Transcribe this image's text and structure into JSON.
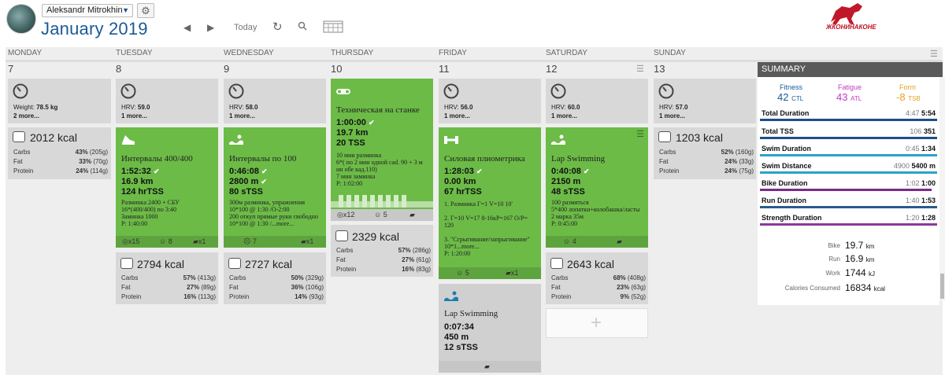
{
  "header": {
    "user": "Aleksandr Mitrokhin",
    "month": "January",
    "year": "2019",
    "today": "Today",
    "logo_text": "ЖКОНИНАКОНЕ"
  },
  "days": [
    {
      "name": "MONDAY",
      "num": "7"
    },
    {
      "name": "TUESDAY",
      "num": "8"
    },
    {
      "name": "WEDNESDAY",
      "num": "9"
    },
    {
      "name": "THURSDAY",
      "num": "10"
    },
    {
      "name": "FRIDAY",
      "num": "11"
    },
    {
      "name": "SATURDAY",
      "num": "12"
    },
    {
      "name": "SUNDAY",
      "num": "13"
    }
  ],
  "metrics": {
    "mon": {
      "label": "Weight:",
      "value": "78.5 kg",
      "more": "2 more..."
    },
    "tue": {
      "label": "HRV:",
      "value": "59.0",
      "more": "1 more..."
    },
    "wed": {
      "label": "HRV:",
      "value": "58.0",
      "more": "1 more..."
    },
    "fri": {
      "label": "HRV:",
      "value": "56.0",
      "more": "1 more..."
    },
    "sat": {
      "label": "HRV:",
      "value": "60.0",
      "more": "1 more..."
    },
    "sun": {
      "label": "HRV:",
      "value": "57.0",
      "more": "1 more..."
    }
  },
  "workouts": {
    "tue": {
      "title": "Интервалы 400/400",
      "duration": "1:52:32",
      "distance": "16.9 km",
      "tss": "124 hrTSS",
      "desc": [
        "Разминка 2400 + СБУ",
        "16*(400/400) по 3:40",
        "Заминка 1000",
        "P: 1:40:00"
      ],
      "f1": "x15",
      "f2": "8",
      "f3": "x1"
    },
    "wed": {
      "title": "Интервалы по 100",
      "duration": "0:46:08",
      "distance": "2800 m",
      "tss": "80 sTSS",
      "desc": [
        "300м разминка, упражнения",
        "10*100 @ 1:30 /О-2:00",
        "200 откуп прямые руки свободно",
        "10*100 @ 1:30 /...more..."
      ],
      "f1": "7",
      "f3": "x1"
    },
    "thu": {
      "title": "Техническая на станке",
      "duration": "1:00:00",
      "distance": "19.7 km",
      "tss": "20 TSS",
      "desc": [
        "10 мин разминка",
        "6*( по 2 мин одной cad. 90 + 3 м",
        "ин обе кад.110)",
        "7 мин заминка",
        "P: 1:02:00"
      ],
      "f1": "x12",
      "f2": "5"
    },
    "fri": {
      "title": "Силовая плиометрика",
      "duration": "1:28:03",
      "distance": "0.00 km",
      "tss": "67 hrTSS",
      "desc": [
        "1. Разминка Г=1 V=10 10'",
        "",
        "2. Г=10 V=17 8-16кР=167 О/Р=",
        "120",
        "",
        "3. \"Сгрыгивание/запрыгивание\"",
        "10*1...more...",
        "P: 1:20:00"
      ],
      "f1": "5",
      "f3": "x1"
    },
    "fri2": {
      "title": "Lap Swimming",
      "duration": "0:07:34",
      "distance": "450 m",
      "tss": "12 sTSS"
    },
    "sat": {
      "title": "Lap Swimming",
      "duration": "0:40:08",
      "distance": "2150 m",
      "tss": "48 sTSS",
      "desc": [
        "100 размяться",
        "5*400 лопатки+колобашка/ласты",
        "2 марка 35м",
        "P: 0:45:00"
      ],
      "f1": "4"
    }
  },
  "nutrition": {
    "mon": {
      "kcal": "2012 kcal",
      "carbs": [
        "43%",
        "(205g)"
      ],
      "fat": [
        "33%",
        "(70g)"
      ],
      "protein": [
        "24%",
        "(114g)"
      ]
    },
    "tue": {
      "kcal": "2794 kcal",
      "carbs": [
        "57%",
        "(413g)"
      ],
      "fat": [
        "27%",
        "(89g)"
      ],
      "protein": [
        "16%",
        "(113g)"
      ]
    },
    "wed": {
      "kcal": "2727 kcal",
      "carbs": [
        "50%",
        "(329g)"
      ],
      "fat": [
        "36%",
        "(106g)"
      ],
      "protein": [
        "14%",
        "(93g)"
      ]
    },
    "thu": {
      "kcal": "2329 kcal",
      "carbs": [
        "57%",
        "(286g)"
      ],
      "fat": [
        "27%",
        "(61g)"
      ],
      "protein": [
        "16%",
        "(83g)"
      ]
    },
    "sat": {
      "kcal": "2643 kcal",
      "carbs": [
        "68%",
        "(408g)"
      ],
      "fat": [
        "23%",
        "(63g)"
      ],
      "protein": [
        "9%",
        "(52g)"
      ]
    },
    "sun": {
      "kcal": "1203 kcal",
      "carbs": [
        "52%",
        "(160g)"
      ],
      "fat": [
        "24%",
        "(33g)"
      ],
      "protein": [
        "24%",
        "(75g)"
      ]
    }
  },
  "macro_labels": {
    "carbs": "Carbs",
    "fat": "Fat",
    "protein": "Protein"
  },
  "summary": {
    "title": "SUMMARY",
    "fitness": {
      "label": "Fitness",
      "value": "42",
      "unit": "CTL"
    },
    "fatigue": {
      "label": "Fatigue",
      "value": "43",
      "unit": "ATL"
    },
    "form": {
      "label": "Form",
      "value": "-8",
      "unit": "TSB"
    },
    "rows": [
      {
        "label": "Total Duration",
        "planned": "4:47",
        "actual": "5:54",
        "fill": 1.0,
        "color": "#1a4f8a"
      },
      {
        "label": "Total TSS",
        "planned": "106",
        "actual": "351",
        "fill": 1.0,
        "color": "#1a4f8a"
      },
      {
        "label": "Swim Duration",
        "planned": "0:45",
        "actual": "1:34",
        "fill": 1.0,
        "color": "#2aa3c8"
      },
      {
        "label": "Swim Distance",
        "planned": "4900",
        "actual": "5400 m",
        "fill": 1.0,
        "color": "#2aa3c8"
      },
      {
        "label": "Bike Duration",
        "planned": "1:02",
        "actual": "1:00",
        "fill": 0.97,
        "color": "#7a2a8a"
      },
      {
        "label": "Run Duration",
        "planned": "1:40",
        "actual": "1:53",
        "fill": 1.0,
        "color": "#2a5a8a"
      },
      {
        "label": "Strength Duration",
        "planned": "1:20",
        "actual": "1:28",
        "fill": 1.0,
        "color": "#8a3a9a"
      }
    ],
    "totals": [
      {
        "label": "Bike",
        "value": "19.7",
        "unit": "km"
      },
      {
        "label": "Run",
        "value": "16.9",
        "unit": "km"
      },
      {
        "label": "Work",
        "value": "1744",
        "unit": "kJ"
      },
      {
        "label": "Calories Consumed",
        "value": "16834",
        "unit": "kcal"
      }
    ]
  },
  "colors": {
    "workout_green": "#6cbb47",
    "fitness": "#1a5a96",
    "fatigue": "#c03cc0",
    "form": "#e8a020"
  }
}
